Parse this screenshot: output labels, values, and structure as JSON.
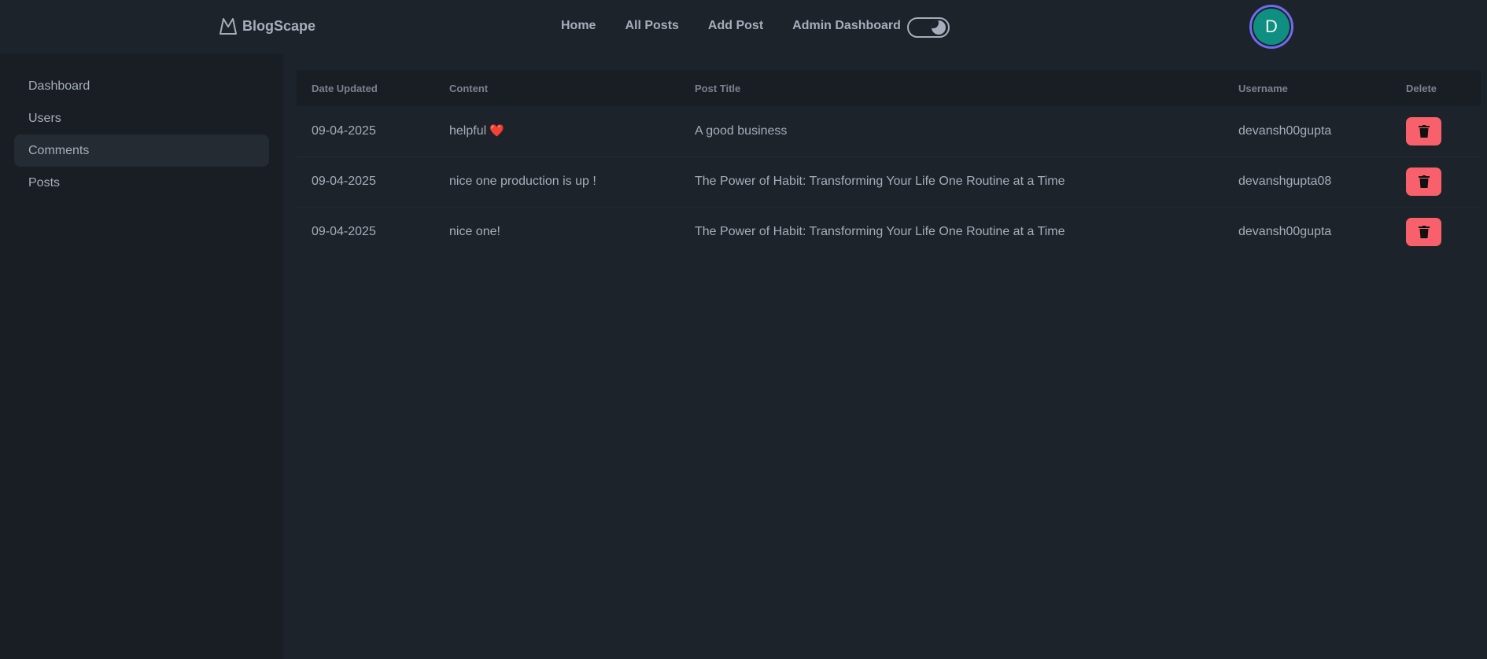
{
  "brand": {
    "name": "BlogScape",
    "icon": "mountain-logo-icon"
  },
  "nav": {
    "links": [
      "Home",
      "All Posts",
      "Add Post",
      "Admin Dashboard"
    ],
    "theme_toggle_icon": "theme-toggle-icon"
  },
  "avatar": {
    "initial": "D"
  },
  "sidebar": {
    "items": [
      {
        "label": "Dashboard",
        "active": false
      },
      {
        "label": "Users",
        "active": false
      },
      {
        "label": "Comments",
        "active": true
      },
      {
        "label": "Posts",
        "active": false
      }
    ]
  },
  "table": {
    "headers": [
      "Date Updated",
      "Content",
      "Post Title",
      "Username",
      "Delete"
    ],
    "rows": [
      {
        "date": "09-04-2025",
        "content": "helpful",
        "emoji": "❤️",
        "post_title": "A good business",
        "username": "devansh00gupta"
      },
      {
        "date": "09-04-2025",
        "content": "nice one production is up !",
        "emoji": "",
        "post_title": "The Power of Habit: Transforming Your Life One Routine at a Time",
        "username": "devanshgupta08"
      },
      {
        "date": "09-04-2025",
        "content": "nice one!",
        "emoji": "",
        "post_title": "The Power of Habit: Transforming Your Life One Routine at a Time",
        "username": "devansh00gupta"
      }
    ],
    "delete_icon": "trash-icon"
  },
  "colors": {
    "background": "#1d232a",
    "sidebar": "#191e24",
    "delete_button": "#f8616b",
    "avatar_bg": "#0f8f82",
    "avatar_ring": "#6f6bf0"
  }
}
